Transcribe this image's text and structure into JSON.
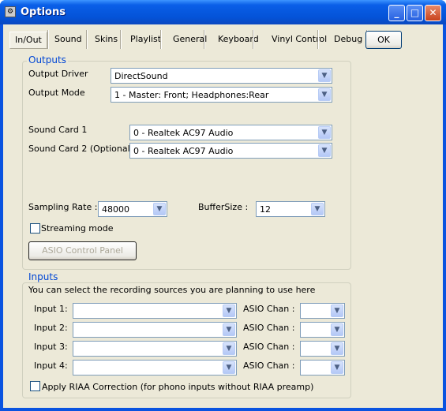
{
  "window": {
    "title": "Options"
  },
  "tabs": [
    "In/Out",
    "Sound",
    "Skins",
    "Playlist",
    "General",
    "Keyboard",
    "Vinyl Control",
    "Debug"
  ],
  "ok_label": "OK",
  "outputs": {
    "title": "Outputs",
    "output_driver_label": "Output Driver",
    "output_driver_value": "DirectSound",
    "output_mode_label": "Output Mode",
    "output_mode_value": "1 - Master: Front; Headphones:Rear",
    "sound_card_1_label": "Sound Card 1",
    "sound_card_1_value": "0 - Realtek AC97 Audio",
    "sound_card_2_label": "Sound Card 2 (Optional)",
    "sound_card_2_value": "0 - Realtek AC97 Audio",
    "sampling_rate_label": "Sampling Rate :",
    "sampling_rate_value": "48000",
    "buffer_size_label": "BufferSize :",
    "buffer_size_value": "12",
    "streaming_mode_label": "Streaming mode",
    "streaming_mode_checked": false,
    "asio_button_label": "ASIO Control Panel"
  },
  "inputs": {
    "title": "Inputs",
    "description": "You can select the recording sources you are planning to use here",
    "rows": [
      {
        "label": "Input 1:",
        "value": "",
        "chan_label": "ASIO Chan :",
        "chan_value": ""
      },
      {
        "label": "Input 2:",
        "value": "",
        "chan_label": "ASIO Chan :",
        "chan_value": ""
      },
      {
        "label": "Input 3:",
        "value": "",
        "chan_label": "ASIO Chan :",
        "chan_value": ""
      },
      {
        "label": "Input 4:",
        "value": "",
        "chan_label": "ASIO Chan :",
        "chan_value": ""
      }
    ],
    "riaa_label": "Apply RIAA Correction (for phono inputs without RIAA preamp)",
    "riaa_checked": false
  }
}
